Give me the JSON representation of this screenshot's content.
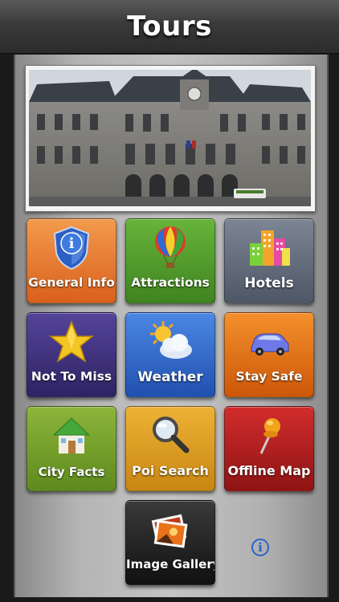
{
  "header": {
    "title": "Tours"
  },
  "tiles": [
    {
      "label": "General Info",
      "color": "#e2732e",
      "icon": "info-shield-icon"
    },
    {
      "label": "Attractions",
      "color": "#4f9a2a",
      "icon": "hot-air-balloon-icon"
    },
    {
      "label": "Hotels",
      "color": "#5e6877",
      "icon": "buildings-icon"
    },
    {
      "label": "Not To Miss",
      "color": "#3f2f7a",
      "icon": "star-icon"
    },
    {
      "label": "Weather",
      "color": "#2f63c4",
      "icon": "sun-cloud-icon"
    },
    {
      "label": "Stay Safe",
      "color": "#e06a14",
      "icon": "car-icon"
    },
    {
      "label": "City Facts",
      "color": "#78a22c",
      "icon": "house-icon"
    },
    {
      "label": "Poi Search",
      "color": "#d99a1c",
      "icon": "magnifier-icon"
    },
    {
      "label": "Offline Map",
      "color": "#b01e1e",
      "icon": "map-pin-icon"
    },
    {
      "label": "Image Gallery",
      "color": "#2a2a2a",
      "icon": "photos-icon"
    }
  ],
  "info_button": {
    "glyph": "i",
    "icon": "info-icon"
  }
}
